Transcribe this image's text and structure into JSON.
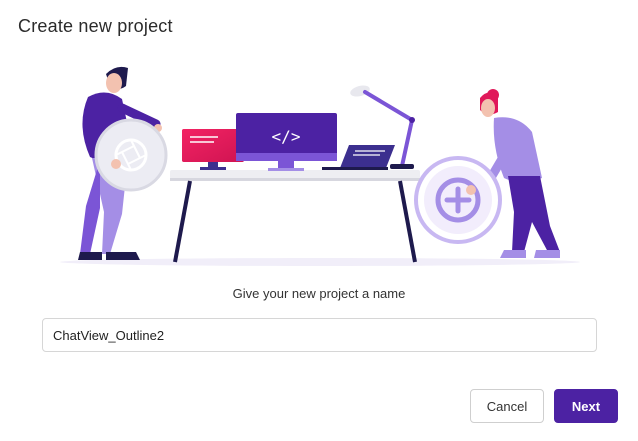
{
  "dialog": {
    "title": "Create new project",
    "prompt": "Give your new project a name",
    "name_input": {
      "value": "ChatView_Outline2",
      "placeholder": ""
    },
    "buttons": {
      "cancel": "Cancel",
      "next": "Next"
    }
  },
  "illustration": {
    "monitor_code_symbol": "</>",
    "icons": [
      "camera-aperture-icon",
      "plus-circle-icon"
    ],
    "colors": {
      "accent": "#4c22a3",
      "purple_light": "#a48ee6",
      "purple_mid": "#7b55d6",
      "pink": "#e0195a",
      "desk": "#1e1a4d"
    }
  }
}
